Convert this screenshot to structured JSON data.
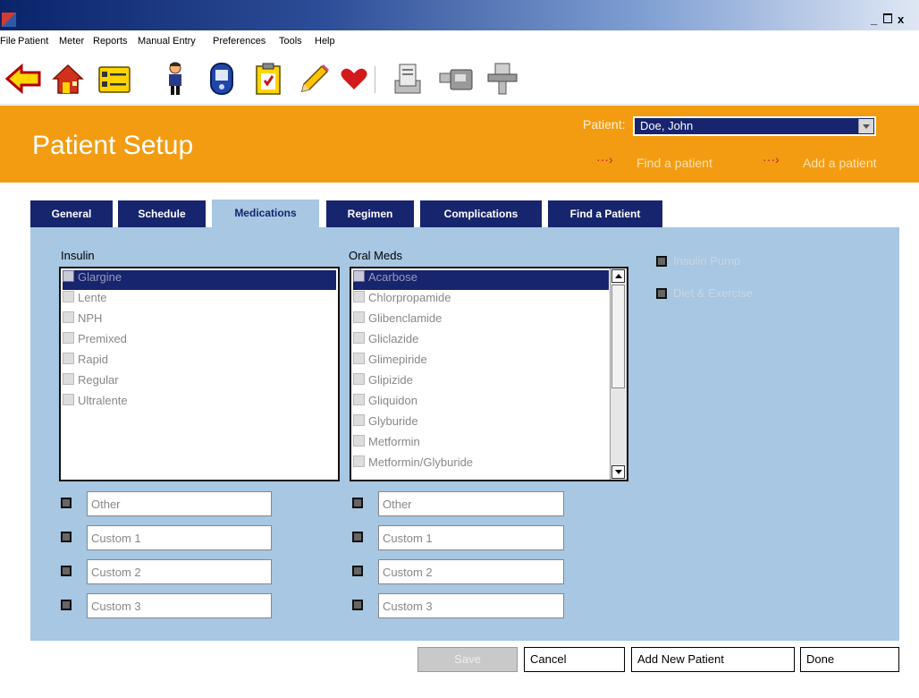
{
  "window": {
    "min": "_",
    "close": "x"
  },
  "menu": [
    "File",
    "Patient",
    "Meter",
    "Reports",
    "Manual Entry",
    "Preferences",
    "Tools",
    "Help"
  ],
  "toolbar_icons": [
    "back-arrow-icon",
    "home-icon",
    "list-icon",
    "person-icon",
    "meter-icon",
    "clipboard-icon",
    "pencil-icon",
    "heart-icon",
    "document-icon",
    "device-icon",
    "cradle-icon"
  ],
  "header": {
    "title": "Patient Setup",
    "patient_label": "Patient:",
    "patient_value": "Doe, John",
    "link_find": "Find a patient",
    "link_add": "Add a patient",
    "arrow_glyph": "···›",
    "bg_color": "#f39c12"
  },
  "tabs": [
    "General",
    "Schedule",
    "Medications",
    "Regimen",
    "Complications",
    "Find a Patient"
  ],
  "active_tab": "Medications",
  "insulin": {
    "label": "Insulin",
    "items": [
      "Glargine",
      "Lente",
      "NPH",
      "Premixed",
      "Rapid",
      "Regular",
      "Ultralente"
    ],
    "selected": "Glargine"
  },
  "oral_meds": {
    "label": "Oral Meds",
    "items": [
      "Acarbose",
      "Chlorpropamide",
      "Glibenclamide",
      "Gliclazide",
      "Glimepiride",
      "Glipizide",
      "Gliquidon",
      "Glyburide",
      "Metformin",
      "Metformin/Glyburide"
    ],
    "selected": "Acarbose"
  },
  "options": {
    "insulin_pump": "Insulin Pump",
    "diet_exercise": "Diet & Exercise"
  },
  "custom_fields": [
    "Other",
    "Custom 1",
    "Custom 2",
    "Custom 3"
  ],
  "buttons": {
    "save": "Save",
    "cancel": "Cancel",
    "add_new_patient": "Add New Patient",
    "done": "Done"
  }
}
